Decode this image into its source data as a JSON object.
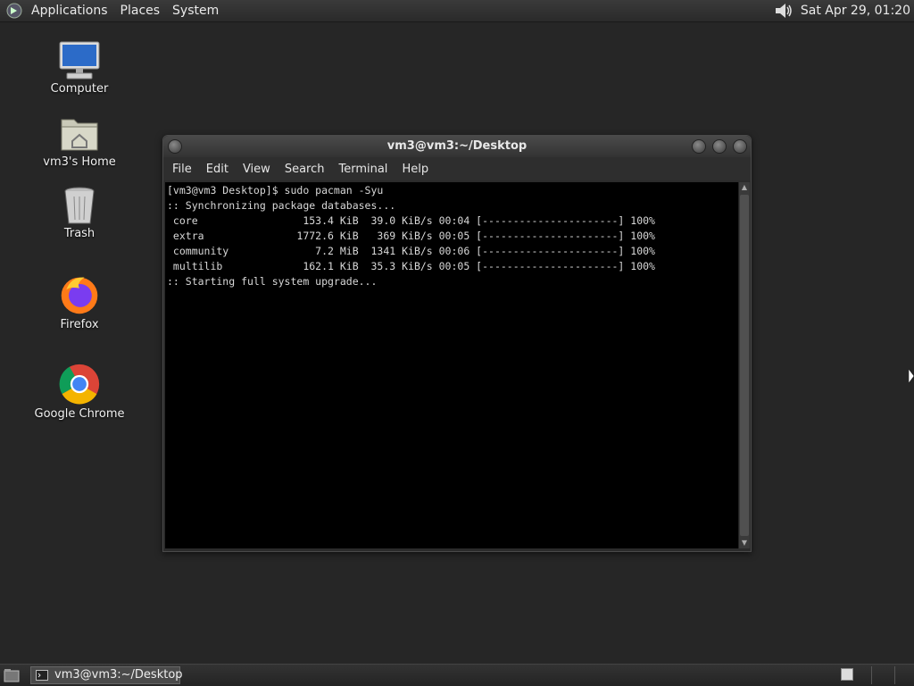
{
  "top_panel": {
    "menus": [
      "Applications",
      "Places",
      "System"
    ],
    "clock": "Sat Apr 29, 01:20",
    "icons": {
      "logo": "gnome-foot-icon",
      "volume": "speaker-icon"
    }
  },
  "desktop": {
    "icons": [
      {
        "label": "Computer",
        "icon": "computer-icon"
      },
      {
        "label": "vm3's Home",
        "icon": "home-folder-icon"
      },
      {
        "label": "Trash",
        "icon": "trash-icon"
      },
      {
        "label": "Firefox",
        "icon": "firefox-icon"
      },
      {
        "label": "Google Chrome",
        "icon": "chrome-icon"
      }
    ]
  },
  "window": {
    "title": "vm3@vm3:~/Desktop",
    "menu": [
      "File",
      "Edit",
      "View",
      "Search",
      "Terminal",
      "Help"
    ],
    "terminal_lines": [
      "[vm3@vm3 Desktop]$ sudo pacman -Syu",
      ":: Synchronizing package databases...",
      " core                 153.4 KiB  39.0 KiB/s 00:04 [----------------------] 100%",
      " extra               1772.6 KiB   369 KiB/s 00:05 [----------------------] 100%",
      " community              7.2 MiB  1341 KiB/s 00:06 [----------------------] 100%",
      " multilib             162.1 KiB  35.3 KiB/s 00:05 [----------------------] 100%",
      ":: Starting full system upgrade..."
    ]
  },
  "bottom_panel": {
    "task_label": "vm3@vm3:~/Desktop"
  },
  "colors": {
    "desktop_bg": "#262626",
    "terminal_bg": "#000000",
    "terminal_fg": "#d8d8d8"
  }
}
